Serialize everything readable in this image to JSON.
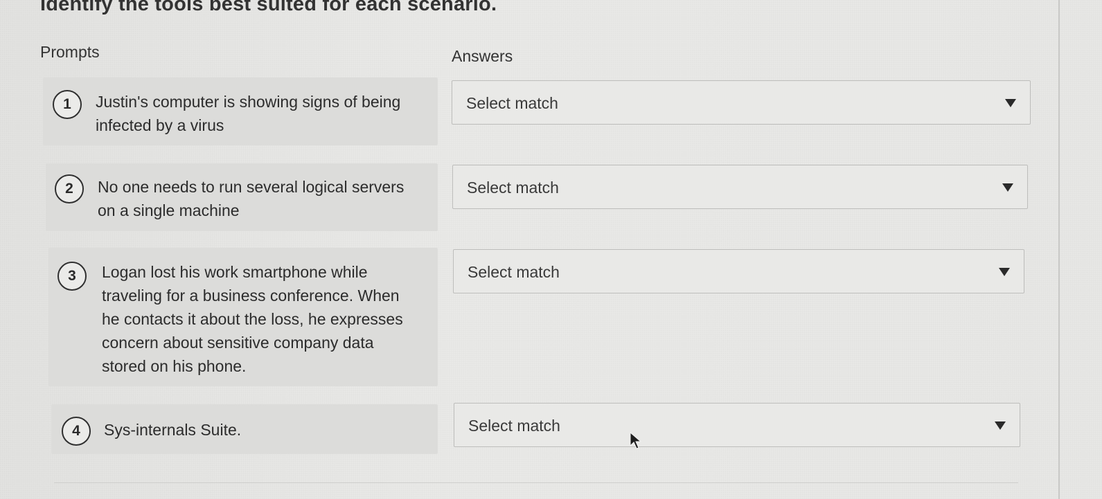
{
  "heading": "Identify the tools best suited for each scenario.",
  "columns": {
    "prompts": "Prompts",
    "answers": "Answers"
  },
  "prompts": [
    {
      "number": "1",
      "lines": [
        "Justin's computer is showing signs of being",
        "infected by a virus"
      ]
    },
    {
      "number": "2",
      "lines": [
        "No one needs to run several logical servers",
        "on a single machine"
      ]
    },
    {
      "number": "3",
      "lines": [
        "Logan lost his work smartphone while",
        "traveling for a business conference. When",
        "he contacts it about the loss, he expresses",
        "concern about sensitive company data",
        "stored on his phone."
      ]
    },
    {
      "number": "4",
      "lines": [
        "Sys-internals Suite."
      ]
    }
  ],
  "answers": [
    {
      "selected": "Select match"
    },
    {
      "selected": "Select match"
    },
    {
      "selected": "Select match"
    },
    {
      "selected": "Select match"
    }
  ],
  "icons": {
    "dropdown": "caret-down-icon",
    "pointer": "mouse-pointer-icon"
  },
  "colors": {
    "background": "#e6e6e4",
    "card": "#dcdcda",
    "text": "#2b2b2b",
    "border": "#bdbdbb"
  }
}
